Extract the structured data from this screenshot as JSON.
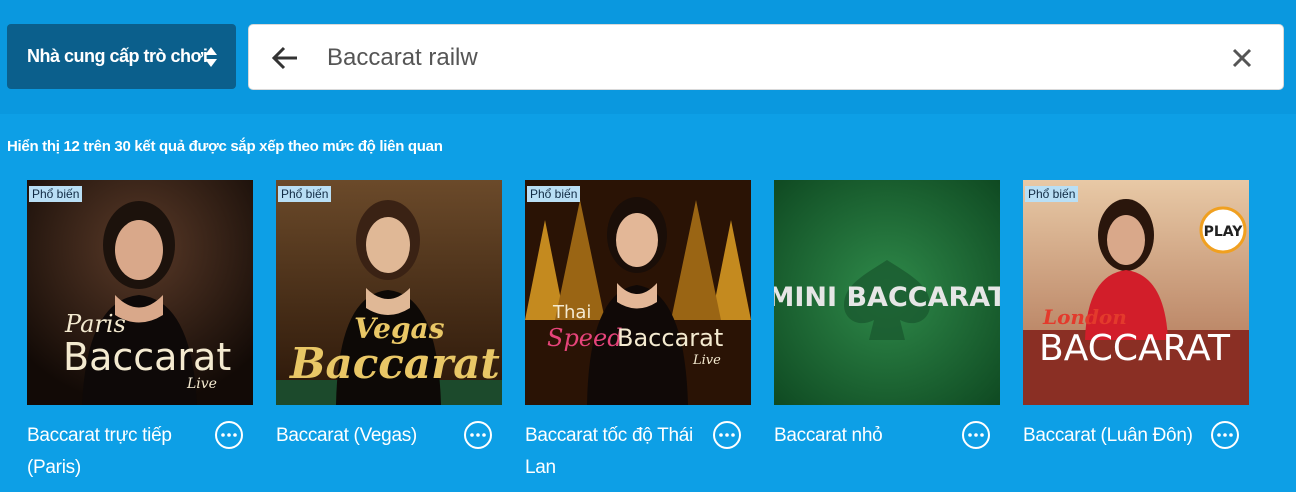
{
  "header": {
    "provider_label": "Nhà cung cấp trò chơi",
    "search_value": "Baccarat railw"
  },
  "results_info": "Hiển thị 12 trên 30 kết quả được sắp xếp theo mức độ liên quan",
  "badge_label": "Phổ biến",
  "games": [
    {
      "title": "Baccarat trực tiếp (Paris)",
      "logo_line1": "Paris",
      "logo_line2": "Baccarat",
      "logo_line3": "Live",
      "popular": true
    },
    {
      "title": "Baccarat (Vegas)",
      "logo_line1": "Vegas",
      "logo_line2": "Baccarat",
      "popular": true
    },
    {
      "title": "Baccarat tốc độ Thái Lan",
      "logo_line1": "Thai",
      "logo_line2a": "Speed",
      "logo_line2b": "Baccarat",
      "logo_line3": "Live",
      "popular": true
    },
    {
      "title": "Baccarat nhỏ",
      "logo_line1": "MINI BACCARAT",
      "popular": false
    },
    {
      "title": "Baccarat (Luân Đôn)",
      "logo_line1": "London",
      "logo_line2": "BACCARAT",
      "play_label": "PLAY",
      "popular": true
    }
  ],
  "colors": {
    "background": "#0d9fe6",
    "provider_button": "#0b5f8c",
    "badge": "#b9dff5"
  }
}
